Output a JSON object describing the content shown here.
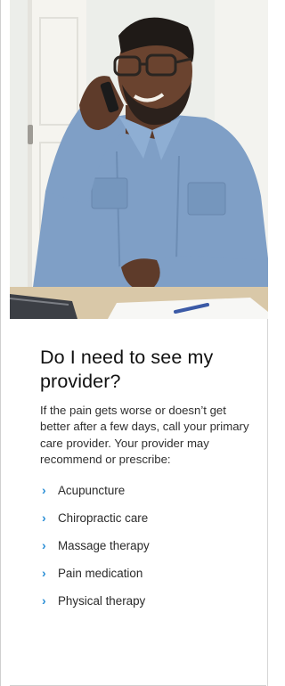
{
  "section": {
    "title": "Do I need to see my provider?",
    "body": "If the pain gets worse or doesn’t get better after a few days, call your primary care provider. Your provider may recommend or prescribe:",
    "bullet_icon": "chevron-right-icon",
    "items": [
      {
        "label": "Acupuncture"
      },
      {
        "label": "Chiropractic care"
      },
      {
        "label": "Massage therapy"
      },
      {
        "label": "Pain medication"
      },
      {
        "label": "Physical therapy"
      }
    ]
  },
  "colors": {
    "accent": "#2b8fd6",
    "shirt": "#7f9fc6",
    "background": "#ffffff"
  }
}
